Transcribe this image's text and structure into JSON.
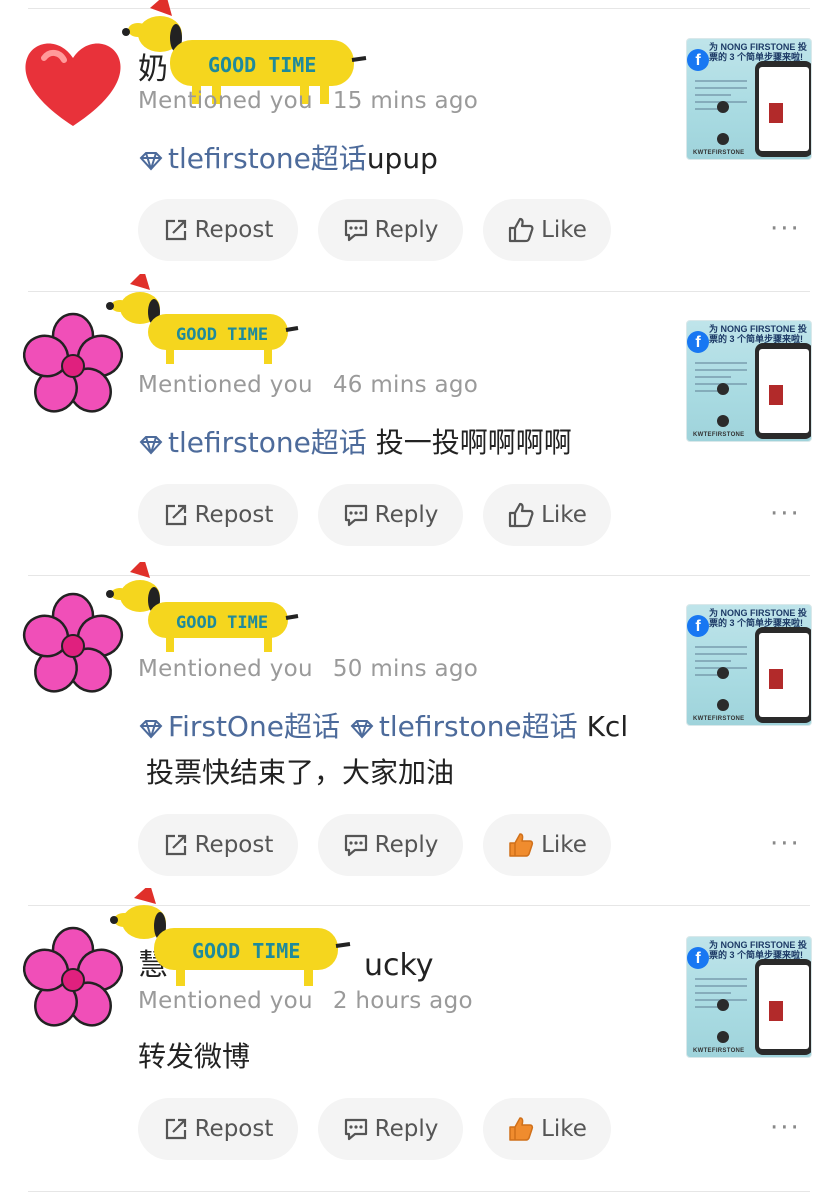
{
  "items": [
    {
      "user_prefix": "奶",
      "meta": "Mentioned you",
      "time": "15 mins ago",
      "topics": [
        "tlefirstone超话"
      ],
      "content": "upup",
      "content2": "",
      "sticker_text": "GOOD TIME",
      "avatar": "heart",
      "liked": false
    },
    {
      "user_prefix": "",
      "meta": "Mentioned you",
      "time": "46 mins ago",
      "topics": [
        "tlefirstone超话"
      ],
      "content": " 投一投啊啊啊啊",
      "content2": "",
      "sticker_text": "GOOD TIME",
      "avatar": "flower",
      "liked": false
    },
    {
      "user_prefix": "",
      "meta": "Mentioned you",
      "time": "50 mins ago",
      "topics": [
        "FirstOne超话",
        "tlefirstone超话"
      ],
      "content": " Kcl",
      "content2": "投票快结束了，大家加油",
      "sticker_text": "GOOD TIME",
      "avatar": "flower",
      "liked": true
    },
    {
      "user_prefix": "慧",
      "user_suffix": "ucky",
      "meta": "Mentioned you",
      "time": "2 hours ago",
      "topics": [],
      "content": "转发微博",
      "content2": "",
      "sticker_text": "GOOD TIME",
      "avatar": "flower",
      "liked": true
    }
  ],
  "actions": {
    "repost": "Repost",
    "reply": "Reply",
    "like": "Like",
    "more": "···"
  },
  "thumbnail": {
    "title": "为 NONG FIRSTONE 投票的 3 个简单步骤来啦!",
    "footer": "KWTEFIRSTONE",
    "fb": "f"
  },
  "colors": {
    "topic": "#4d6b9b",
    "like_active": "#f08c2e",
    "button_bg": "#f4f4f4",
    "flower": "#f04fb8"
  },
  "icons": [
    "repost-icon",
    "reply-icon",
    "like-icon",
    "more-icon",
    "topic-diamond-icon",
    "heart-avatar",
    "flower-avatar",
    "dog-sticker"
  ]
}
